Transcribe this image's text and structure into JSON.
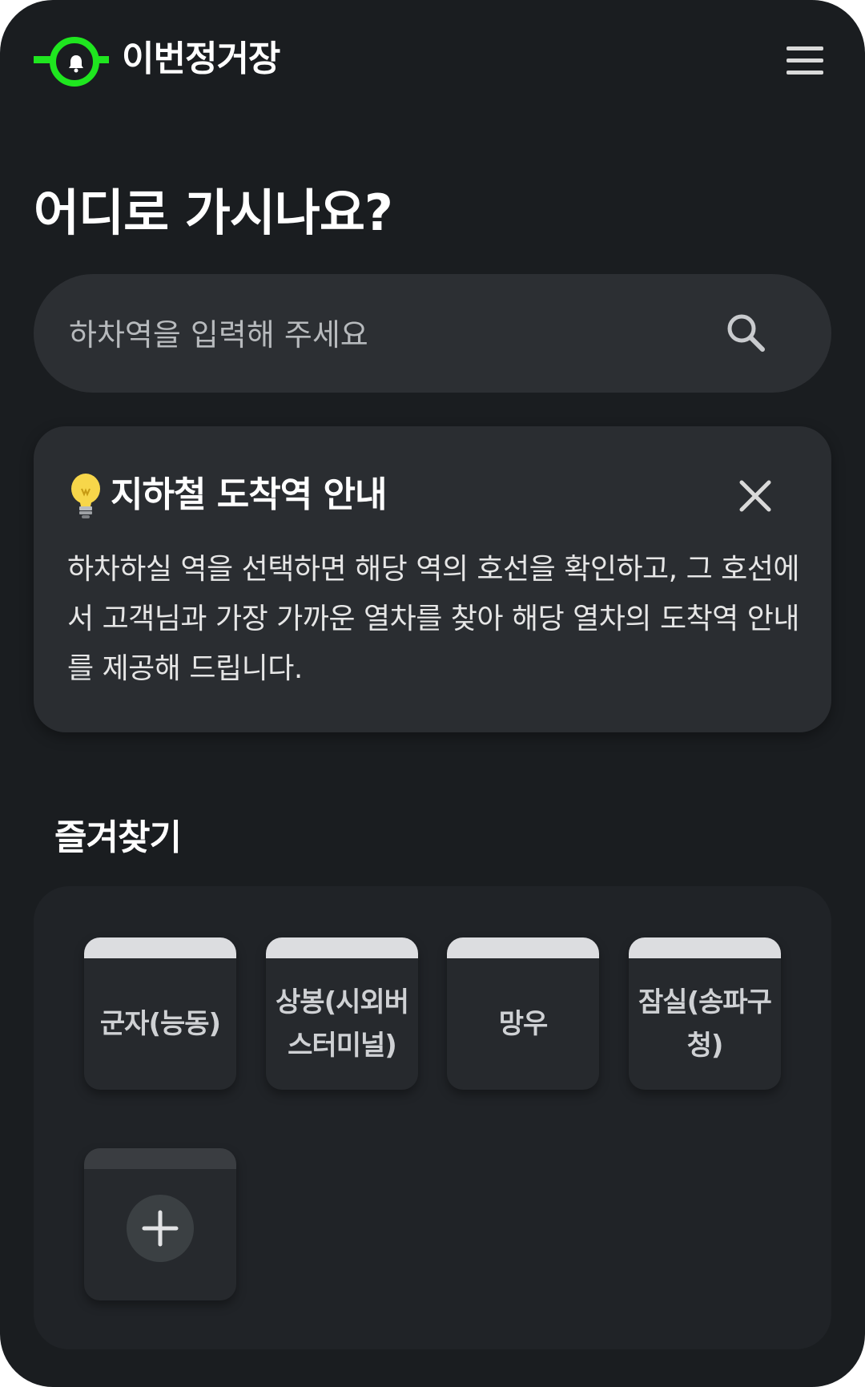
{
  "header": {
    "brand": "이번정거장",
    "logo_icon": "bell-station-icon",
    "menu_icon": "hamburger-menu-icon",
    "accent_color": "#1fe61f"
  },
  "main": {
    "title": "어디로 가시나요?",
    "search": {
      "placeholder": "하차역을 입력해 주세요",
      "value": "",
      "icon": "search-icon"
    }
  },
  "info": {
    "icon": "lightbulb-icon",
    "title": "지하철 도착역 안내",
    "close_icon": "close-icon",
    "body": "하차하실 역을 선택하면 해당 역의 호선을 확인하고, 그 호선에서 고객님과 가장 가까운 열차를 찾아 해당 열차의 도착역 안내를 제공해 드립니다."
  },
  "favorites": {
    "title": "즐겨찾기",
    "items": [
      {
        "label": "군자(능동)"
      },
      {
        "label": "상봉(시외버스터미널)"
      },
      {
        "label": "망우"
      },
      {
        "label": "잠실(송파구청)"
      }
    ],
    "add_icon": "plus-icon"
  }
}
